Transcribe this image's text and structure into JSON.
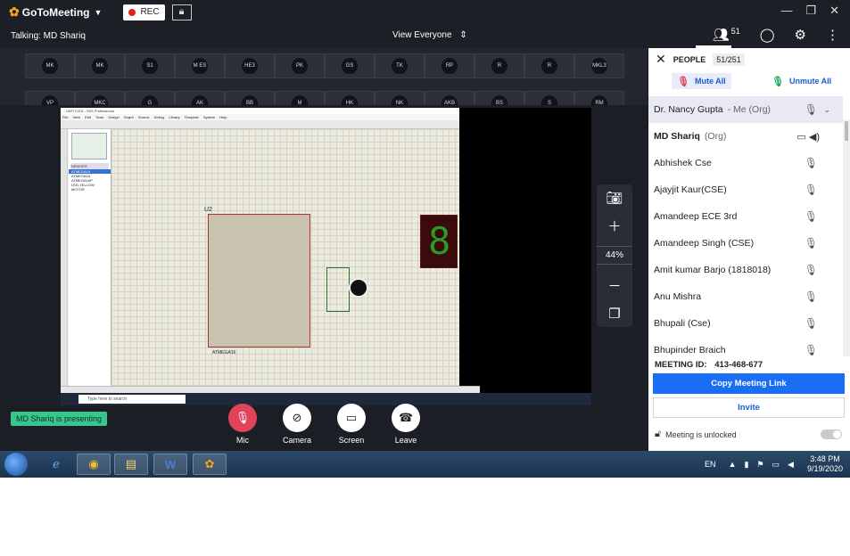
{
  "app": {
    "name": "GoToMeeting",
    "rec_label": "REC"
  },
  "infobar": {
    "talking": "Talking: MD Shariq",
    "view": "View Everyone",
    "people_count": "51"
  },
  "thumbnails": {
    "row1": [
      "MK",
      "MK",
      "S1",
      "M ES",
      "HE3",
      "PK",
      "GS",
      "TK",
      "RP",
      "R",
      "R",
      "MKL3"
    ],
    "row2": [
      "VP",
      "MKC",
      "G",
      "AK",
      "BB",
      "M",
      "HK",
      "NK",
      "AKB",
      "BS",
      "S",
      "RM"
    ]
  },
  "shared_screen": {
    "app_title": "UNTITLED - ISIS Professional",
    "menu": [
      "File",
      "View",
      "Edit",
      "Tools",
      "Design",
      "Graph",
      "Source",
      "Debug",
      "Library",
      "Template",
      "System",
      "Help"
    ],
    "devices_header": "DEVICES",
    "devices": [
      "ATMEGA16",
      "ATMEGA16",
      "ATMEGA16P",
      "LED-YELLOW",
      "MOTOR"
    ],
    "mcu_ref": "U2",
    "mcu_part": "ATMEGA16",
    "seven_seg_digit": "8",
    "search_placeholder": "Type here to search"
  },
  "zoom": {
    "percent": "44%"
  },
  "presenting": "MD Shariq is presenting",
  "controls": {
    "mic": "Mic",
    "camera": "Camera",
    "screen": "Screen",
    "leave": "Leave"
  },
  "people_panel": {
    "title": "PEOPLE",
    "count": "51/251",
    "mute_all": "Mute All",
    "unmute_all": "Unmute All",
    "participants": [
      {
        "name": "Dr. Nancy Gupta",
        "tag": "- Me (Org)"
      },
      {
        "name": "MD Shariq",
        "tag": "(Org)"
      },
      {
        "name": "Abhishek Cse",
        "tag": ""
      },
      {
        "name": "Ajayjit Kaur(CSE)",
        "tag": ""
      },
      {
        "name": "Amandeep ECE 3rd",
        "tag": ""
      },
      {
        "name": "Amandeep Singh (CSE)",
        "tag": ""
      },
      {
        "name": "Amit kumar Barjo (1818018)",
        "tag": ""
      },
      {
        "name": "Anu Mishra",
        "tag": ""
      },
      {
        "name": "Bhupali (Cse)",
        "tag": ""
      },
      {
        "name": "Bhupinder Braich",
        "tag": ""
      }
    ],
    "meeting_id_label": "MEETING ID:",
    "meeting_id": "413-468-677",
    "copy_link": "Copy Meeting Link",
    "invite": "Invite",
    "lock_status": "Meeting is unlocked"
  },
  "taskbar": {
    "lang": "EN",
    "time": "3:48 PM",
    "date": "9/19/2020"
  },
  "colors": {
    "accent": "#1a6ef5",
    "presenting_badge": "#37c68b",
    "mic_muted": "#e0445a"
  }
}
